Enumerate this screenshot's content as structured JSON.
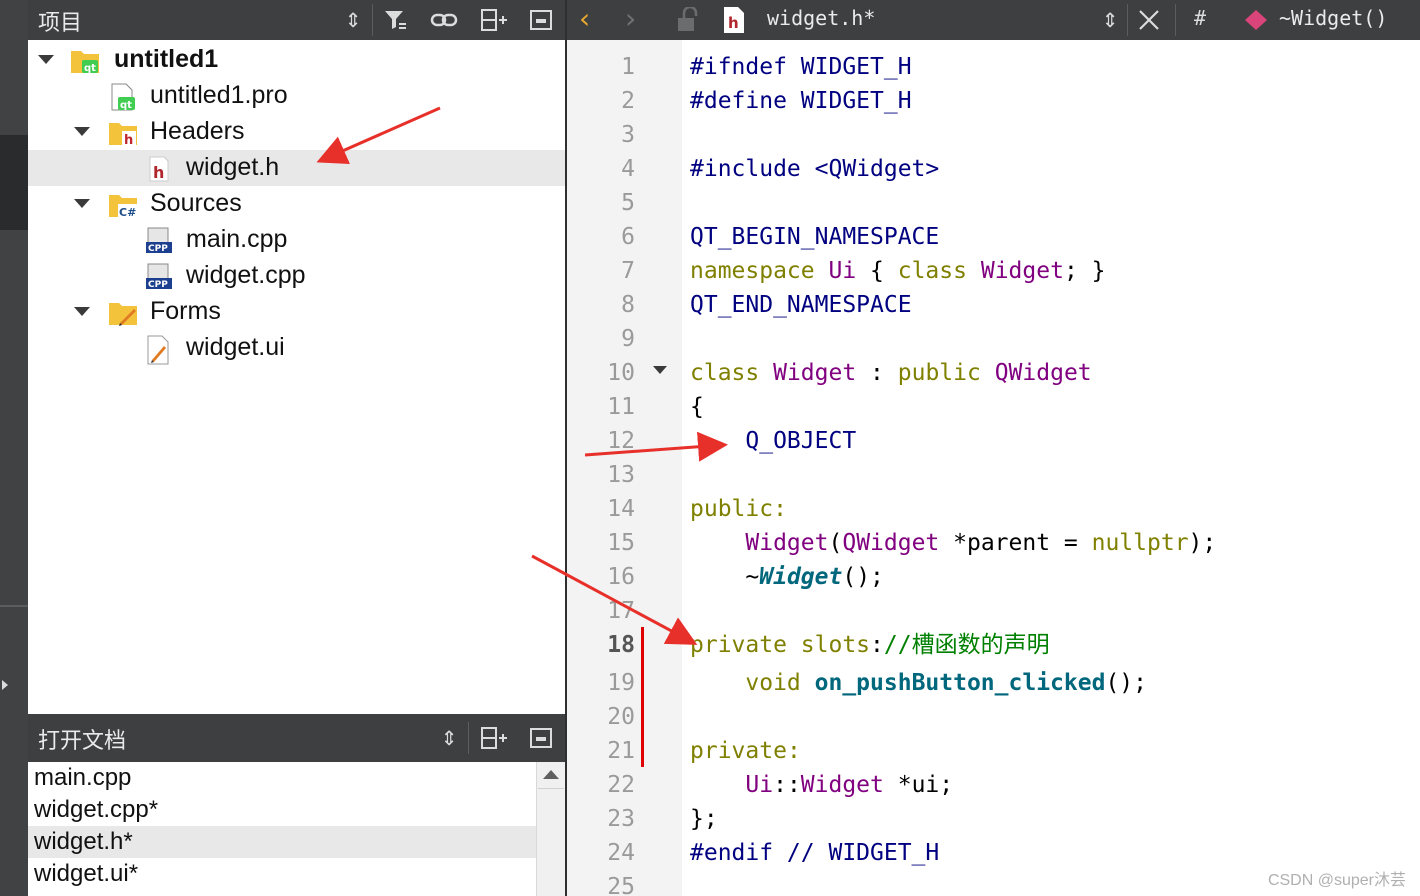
{
  "projects_pane": {
    "title": "项目",
    "tree": [
      {
        "label": "untitled1",
        "icon": "qt-project-folder-icon",
        "expanded": true
      },
      {
        "label": "untitled1.pro",
        "icon": "qt-pro-file-icon"
      },
      {
        "label": "Headers",
        "icon": "headers-folder-icon",
        "expanded": true
      },
      {
        "label": "widget.h",
        "icon": "header-file-icon",
        "selected": true
      },
      {
        "label": "Sources",
        "icon": "sources-folder-icon",
        "expanded": true
      },
      {
        "label": "main.cpp",
        "icon": "cpp-file-icon"
      },
      {
        "label": "widget.cpp",
        "icon": "cpp-file-icon"
      },
      {
        "label": "Forms",
        "icon": "forms-folder-icon",
        "expanded": true
      },
      {
        "label": "widget.ui",
        "icon": "ui-file-icon"
      }
    ]
  },
  "open_documents": {
    "title": "打开文档",
    "items": [
      {
        "label": "main.cpp"
      },
      {
        "label": "widget.cpp*"
      },
      {
        "label": "widget.h*",
        "selected": true
      },
      {
        "label": "widget.ui*"
      }
    ]
  },
  "editor": {
    "file_name": "widget.h*",
    "symbol": "~Widget()",
    "hash_label": "#",
    "line_numbers": [
      "1",
      "2",
      "3",
      "4",
      "5",
      "6",
      "7",
      "8",
      "9",
      "10",
      "11",
      "12",
      "13",
      "14",
      "15",
      "16",
      "17",
      "18",
      "19",
      "20",
      "21",
      "22",
      "23",
      "24",
      "25"
    ],
    "current_line": 18,
    "lines": [
      "#ifndef WIDGET_H",
      "#define WIDGET_H",
      "",
      "#include <QWidget>",
      "",
      "QT_BEGIN_NAMESPACE",
      "namespace Ui { class Widget; }",
      "QT_END_NAMESPACE",
      "",
      "class Widget : public QWidget",
      "{",
      "    Q_OBJECT",
      "",
      "public:",
      "    Widget(QWidget *parent = nullptr);",
      "    ~Widget();",
      "",
      "private slots://槽函数的声明",
      "    void on_pushButton_clicked();",
      "",
      "private:",
      "    Ui::Widget *ui;",
      "};",
      "#endif // WIDGET_H",
      ""
    ]
  },
  "colors": {
    "keyword": "#808000",
    "type": "#800080",
    "preprocessor": "#000080",
    "comment": "#008000",
    "function": "#00677c",
    "annotation_arrow": "#e8302a",
    "toolbar_bg": "#3d3f41"
  },
  "watermark": "CSDN @super沐芸"
}
